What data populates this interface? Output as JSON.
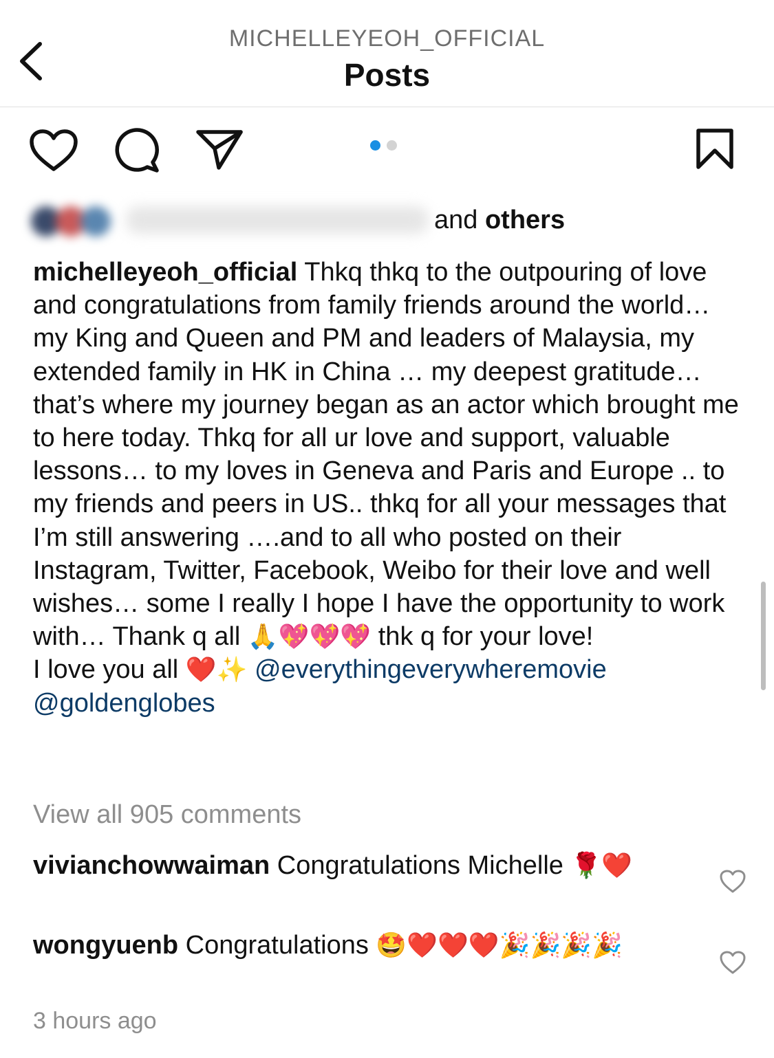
{
  "header": {
    "username": "MICHELLEYEOH_OFFICIAL",
    "title": "Posts"
  },
  "post": {
    "carousel_dots": 2,
    "carousel_active": 1,
    "likes": {
      "text_suffix_plain": "and",
      "text_suffix_bold": "others"
    },
    "caption": {
      "author": "michelleyeoh_official",
      "text": "Thkq thkq to the outpouring of love and congratulations from family friends around the world… my King and Queen and PM and leaders of Malaysia, my extended family in HK in China … my deepest gratitude… that’s where my journey began as an actor which brought me to here today. Thkq for all ur love and support, valuable lessons… to my loves in Geneva and Paris and Europe .. to my friends and peers in US.. thkq for all your messages that I’m still answering ….and to all who posted on their Instagram, Twitter, Facebook, Weibo for their love and well wishes… some I really I hope I have the opportunity to work with… Thank q all",
      "emojis_1": "🙏💖💖💖",
      "text_2": "thk q for your love!",
      "line_2": "I love you all",
      "emojis_2": "❤️✨",
      "mention_1": "@everythingeverywheremovie",
      "mention_2": "@goldenglobes"
    },
    "view_all_comments": "View all 905 comments",
    "comments": [
      {
        "user": "vivianchowwaiman",
        "text": "Congratulations Michelle",
        "emojis": "🌹❤️"
      },
      {
        "user": "wongyuenb",
        "text": "Congratulations",
        "emojis": "🤩❤️❤️❤️🎉🎉🎉🎉"
      }
    ],
    "timestamp": "3 hours ago"
  },
  "icons": [
    "back-arrow-icon",
    "heart-icon",
    "comment-icon",
    "share-icon",
    "bookmark-icon",
    "comment-like-icon"
  ],
  "colors": {
    "text": "#111111",
    "muted": "#8e8e8e",
    "mention": "#0d3b66",
    "dot_active": "#1a8fe3",
    "dot_inactive": "#d3d3d3"
  }
}
